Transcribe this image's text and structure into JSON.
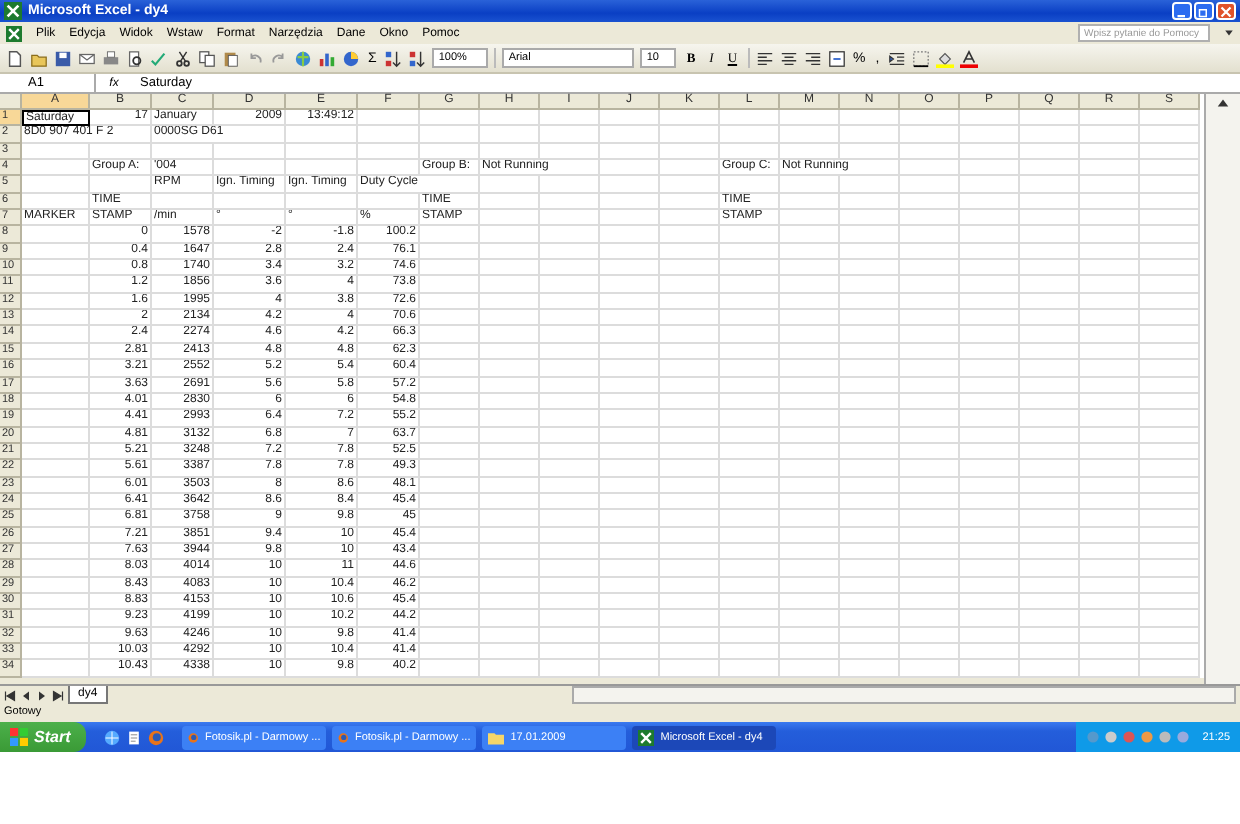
{
  "window": {
    "title": "Microsoft Excel - dy4"
  },
  "menu": [
    "Plik",
    "Edycja",
    "Widok",
    "Wstaw",
    "Format",
    "Narzędzia",
    "Dane",
    "Okno",
    "Pomoc"
  ],
  "help_field": {
    "placeholder": "Wpisz pytanie do Pomocy"
  },
  "toolbar": {
    "sum": "Σ",
    "zoom": "100%",
    "font": "Arial",
    "size": "10",
    "format_buttons": [
      "B",
      "I",
      "U"
    ],
    "percent": "%",
    "comma": ","
  },
  "formula_bar": {
    "name_box": "A1",
    "fx": "fx",
    "value": "Saturday"
  },
  "columns": [
    {
      "label": "A",
      "selected": true
    },
    {
      "label": "B",
      "selected": false
    },
    {
      "label": "C",
      "selected": false
    },
    {
      "label": "D",
      "selected": false
    },
    {
      "label": "E",
      "selected": false
    },
    {
      "label": "F",
      "selected": false
    },
    {
      "label": "G",
      "selected": false
    },
    {
      "label": "H",
      "selected": false
    },
    {
      "label": "I",
      "selected": false
    },
    {
      "label": "J",
      "selected": false
    },
    {
      "label": "K",
      "selected": false
    },
    {
      "label": "L",
      "selected": false
    },
    {
      "label": "M",
      "selected": false
    },
    {
      "label": "N",
      "selected": false
    },
    {
      "label": "O",
      "selected": false
    },
    {
      "label": "P",
      "selected": false
    },
    {
      "label": "Q",
      "selected": false
    },
    {
      "label": "R",
      "selected": false
    },
    {
      "label": "S",
      "selected": false
    }
  ],
  "rows": [
    {
      "number": "1",
      "selected": true,
      "kind": "text",
      "text": {
        "A": "Saturday",
        "C": "January"
      },
      "numbers": {
        "B": "17",
        "D": "2009",
        "E": "13:49:12"
      }
    },
    {
      "number": "2",
      "selected": false,
      "kind": "text",
      "text": {
        "A": "8D0 907 401 F 2",
        "C": "0000SG  D61"
      }
    },
    {
      "number": "3",
      "selected": false,
      "kind": "text"
    },
    {
      "number": "4",
      "selected": false,
      "kind": "text",
      "text": {
        "B": "Group A:",
        "C": "'004",
        "G": "Group B:",
        "H": "Not Running",
        "L": "Group C:",
        "M": "Not Running"
      }
    },
    {
      "number": "5",
      "selected": false,
      "kind": "text",
      "text": {
        "C": "RPM",
        "D": "Ign. Timing",
        "E": "Ign. Timing",
        "F": "Duty Cycle"
      }
    },
    {
      "number": "6",
      "selected": false,
      "kind": "text",
      "text": {
        "B": "TIME",
        "G": "TIME",
        "L": "TIME"
      }
    },
    {
      "number": "7",
      "selected": false,
      "kind": "text",
      "text": {
        "A": "MARKER",
        "B": "STAMP",
        "C": "/min",
        "D": "°",
        "E": "°",
        "F": "%",
        "G": "STAMP",
        "L": "STAMP"
      }
    },
    {
      "number": "8",
      "selected": false,
      "kind": "data",
      "values": [
        "0",
        "1578",
        "-2",
        "-1.8",
        "100.2"
      ]
    },
    {
      "number": "9",
      "selected": false,
      "kind": "data",
      "values": [
        "0.4",
        "1647",
        "2.8",
        "2.4",
        "76.1"
      ]
    },
    {
      "number": "10",
      "selected": false,
      "kind": "data",
      "values": [
        "0.8",
        "1740",
        "3.4",
        "3.2",
        "74.6"
      ]
    },
    {
      "number": "11",
      "selected": false,
      "kind": "data",
      "values": [
        "1.2",
        "1856",
        "3.6",
        "4",
        "73.8"
      ]
    },
    {
      "number": "12",
      "selected": false,
      "kind": "data",
      "values": [
        "1.6",
        "1995",
        "4",
        "3.8",
        "72.6"
      ]
    },
    {
      "number": "13",
      "selected": false,
      "kind": "data",
      "values": [
        "2",
        "2134",
        "4.2",
        "4",
        "70.6"
      ]
    },
    {
      "number": "14",
      "selected": false,
      "kind": "data",
      "values": [
        "2.4",
        "2274",
        "4.6",
        "4.2",
        "66.3"
      ]
    },
    {
      "number": "15",
      "selected": false,
      "kind": "data",
      "values": [
        "2.81",
        "2413",
        "4.8",
        "4.8",
        "62.3"
      ]
    },
    {
      "number": "16",
      "selected": false,
      "kind": "data",
      "values": [
        "3.21",
        "2552",
        "5.2",
        "5.4",
        "60.4"
      ]
    },
    {
      "number": "17",
      "selected": false,
      "kind": "data",
      "values": [
        "3.63",
        "2691",
        "5.6",
        "5.8",
        "57.2"
      ]
    },
    {
      "number": "18",
      "selected": false,
      "kind": "data",
      "values": [
        "4.01",
        "2830",
        "6",
        "6",
        "54.8"
      ]
    },
    {
      "number": "19",
      "selected": false,
      "kind": "data",
      "values": [
        "4.41",
        "2993",
        "6.4",
        "7.2",
        "55.2"
      ]
    },
    {
      "number": "20",
      "selected": false,
      "kind": "data",
      "values": [
        "4.81",
        "3132",
        "6.8",
        "7",
        "63.7"
      ]
    },
    {
      "number": "21",
      "selected": false,
      "kind": "data",
      "values": [
        "5.21",
        "3248",
        "7.2",
        "7.8",
        "52.5"
      ]
    },
    {
      "number": "22",
      "selected": false,
      "kind": "data",
      "values": [
        "5.61",
        "3387",
        "7.8",
        "7.8",
        "49.3"
      ]
    },
    {
      "number": "23",
      "selected": false,
      "kind": "data",
      "values": [
        "6.01",
        "3503",
        "8",
        "8.6",
        "48.1"
      ]
    },
    {
      "number": "24",
      "selected": false,
      "kind": "data",
      "values": [
        "6.41",
        "3642",
        "8.6",
        "8.4",
        "45.4"
      ]
    },
    {
      "number": "25",
      "selected": false,
      "kind": "data",
      "values": [
        "6.81",
        "3758",
        "9",
        "9.8",
        "45"
      ]
    },
    {
      "number": "26",
      "selected": false,
      "kind": "data",
      "values": [
        "7.21",
        "3851",
        "9.4",
        "10",
        "45.4"
      ]
    },
    {
      "number": "27",
      "selected": false,
      "kind": "data",
      "values": [
        "7.63",
        "3944",
        "9.8",
        "10",
        "43.4"
      ]
    },
    {
      "number": "28",
      "selected": false,
      "kind": "data",
      "values": [
        "8.03",
        "4014",
        "10",
        "11",
        "44.6"
      ]
    },
    {
      "number": "29",
      "selected": false,
      "kind": "data",
      "values": [
        "8.43",
        "4083",
        "10",
        "10.4",
        "46.2"
      ]
    },
    {
      "number": "30",
      "selected": false,
      "kind": "data",
      "values": [
        "8.83",
        "4153",
        "10",
        "10.6",
        "45.4"
      ]
    },
    {
      "number": "31",
      "selected": false,
      "kind": "data",
      "values": [
        "9.23",
        "4199",
        "10",
        "10.2",
        "44.2"
      ]
    },
    {
      "number": "32",
      "selected": false,
      "kind": "data",
      "values": [
        "9.63",
        "4246",
        "10",
        "9.8",
        "41.4"
      ]
    },
    {
      "number": "33",
      "selected": false,
      "kind": "data",
      "values": [
        "10.03",
        "4292",
        "10",
        "10.4",
        "41.4"
      ]
    },
    {
      "number": "34",
      "selected": false,
      "kind": "data",
      "values": [
        "10.43",
        "4338",
        "10",
        "9.8",
        "40.2"
      ]
    }
  ],
  "sheet_tabs": [
    {
      "label": "dy4",
      "selected": true
    }
  ],
  "status_bar": "Gotowy",
  "taskbar": {
    "start": "Start",
    "buttons": [
      {
        "label": "Fotosik.pl - Darmowy ...",
        "kind": "browser",
        "selected": false
      },
      {
        "label": "Fotosik.pl - Darmowy ...",
        "kind": "browser",
        "selected": false
      },
      {
        "label": "17.01.2009",
        "kind": "folder",
        "selected": false
      },
      {
        "label": "Microsoft Excel - dy4",
        "kind": "excel",
        "selected": true
      }
    ],
    "clock": "21:25"
  }
}
